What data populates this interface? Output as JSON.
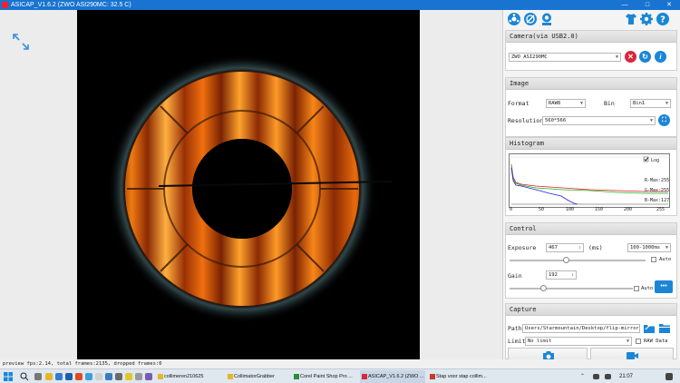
{
  "window": {
    "title": "ASICAP_V1.6.2 (ZWO ASI290MC: 32.5 C)"
  },
  "colors": {
    "accent": "#1b86d6",
    "titlebar": "#1874d0",
    "close_red": "#d9263a",
    "preview_bg": "#000000"
  },
  "icons": {
    "expand": "expand-arrows-icon",
    "top": [
      "camera-wheel-icon",
      "focuser-icon",
      "guide-icon",
      "shirt-icon",
      "settings-gear-icon",
      "help-icon"
    ]
  },
  "camera": {
    "header": "Camera(via USB2.0)",
    "selected": "ZWO ASI290MC"
  },
  "image": {
    "header": "Image",
    "format_label": "Format",
    "format_value": "RAW8",
    "bin_label": "Bin",
    "bin_value": "Bin1",
    "resolution_label": "Resolution",
    "resolution_value": "560*566"
  },
  "histogram": {
    "header": "Histogram",
    "log_label": "Log",
    "rmax": "R-Max:255",
    "gmax": "G-Max:255",
    "bmax": "B-Max:127",
    "ticks": [
      "0",
      "50",
      "100",
      "150",
      "200",
      "255"
    ]
  },
  "control": {
    "header": "Control",
    "exposure_label": "Exposure",
    "exposure_value": "467",
    "exposure_unit": "(ms)",
    "exposure_range": "100-1000ms",
    "gain_label": "Gain",
    "gain_value": "192",
    "auto_label": "Auto",
    "auto2_label": "Auto",
    "more_label": "•••",
    "exposure_slider_fraction": 0.41,
    "gain_slider_fraction": 0.27
  },
  "capture": {
    "header": "Capture",
    "path_label": "Path",
    "path_value": "Users/Starmountain/Desktop/flip-mirror",
    "limit_label": "Limit",
    "limit_value": "No limit",
    "raw_label": "RAW Data"
  },
  "status": {
    "text": "preview fps:2.14, total frames:2135, dropped frames:0"
  },
  "taskbar": {
    "items": [
      "collimeren210625",
      "CollimatorGrabber",
      "Corel Paint Shop Pro ...",
      "ASICAP_V1.6.2 (ZWO ...",
      "Stap voor stap collim..."
    ],
    "time": "21:07"
  }
}
